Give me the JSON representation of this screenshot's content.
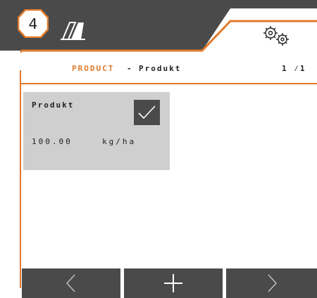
{
  "header": {
    "badge_number": "4",
    "mode_icon": "planter-mode-icon",
    "settings_icon": "gears-icon",
    "accent_color": "#e07a2b",
    "panel_color": "#4a4a4a"
  },
  "page": {
    "title_left": "PRODUCT",
    "title_separator": "-",
    "title_right": "Produkt",
    "page_indicator": "1 ⁄1"
  },
  "card": {
    "name": "Produkt",
    "selected": true,
    "value": "100.00",
    "unit": "kg/ha"
  },
  "bottom_bar": {
    "prev_icon": "chevron-left-icon",
    "add_icon": "plus-icon",
    "next_icon": "chevron-right-icon"
  }
}
